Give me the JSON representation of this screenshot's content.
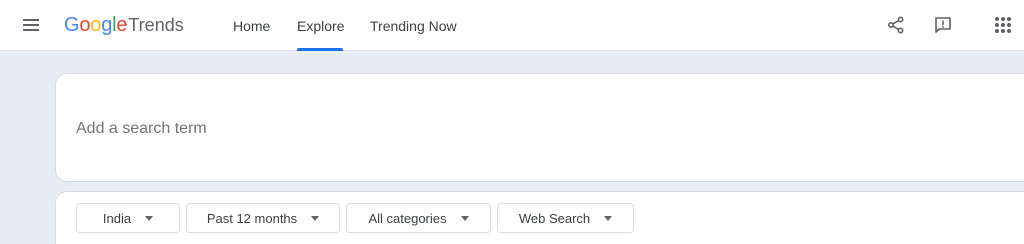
{
  "header": {
    "menu_icon": "hamburger-menu-icon",
    "logo": {
      "google_letters": [
        {
          "ch": "G",
          "color": "#4285F4"
        },
        {
          "ch": "o",
          "color": "#EA4335"
        },
        {
          "ch": "o",
          "color": "#FBBC05"
        },
        {
          "ch": "g",
          "color": "#4285F4"
        },
        {
          "ch": "l",
          "color": "#34A853"
        },
        {
          "ch": "e",
          "color": "#EA4335"
        }
      ],
      "product": "Trends"
    },
    "nav": {
      "home": "Home",
      "explore": "Explore",
      "trending": "Trending Now",
      "active": "Explore"
    },
    "icons": {
      "share": "share-icon",
      "feedback": "feedback-icon",
      "apps": "apps-grid-icon"
    }
  },
  "search": {
    "placeholder": "Add a search term",
    "value": ""
  },
  "filters": {
    "geo": "India",
    "time": "Past 12 months",
    "category": "All categories",
    "property": "Web Search"
  },
  "colors": {
    "accent": "#1a73e8",
    "page_background": "#e8ecf4",
    "icon_gray": "#5f6368"
  }
}
